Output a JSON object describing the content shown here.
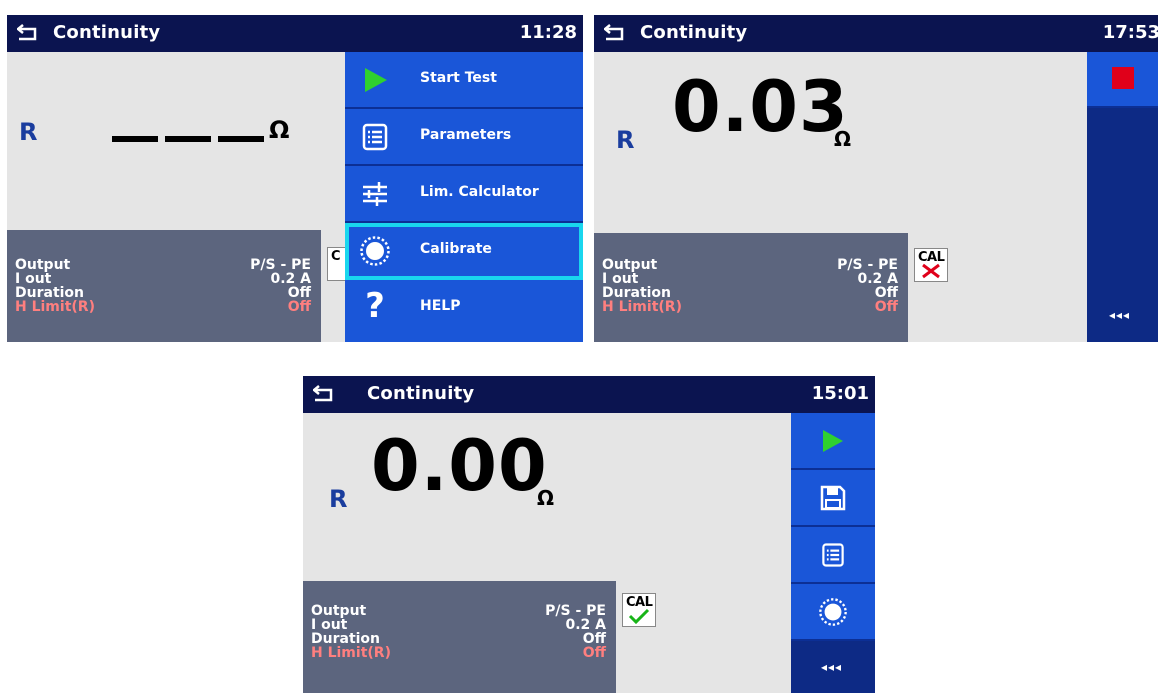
{
  "screens": [
    {
      "title": "Continuity",
      "time": "11:28",
      "r_label": "R",
      "unit": "Ω",
      "params": [
        {
          "label": "Output",
          "value": "P/S - PE"
        },
        {
          "label": "I out",
          "value": "0.2 A"
        },
        {
          "label": "Duration",
          "value": "Off"
        },
        {
          "label": "H Limit(R)",
          "value": "Off"
        }
      ],
      "menu": [
        {
          "label": "Start Test",
          "icon": "play-icon"
        },
        {
          "label": "Parameters",
          "icon": "list-icon"
        },
        {
          "label": "Lim. Calculator",
          "icon": "sliders-icon"
        },
        {
          "label": "Calibrate",
          "icon": "calibrate-icon",
          "selected": true
        },
        {
          "label": "HELP",
          "icon": "help-icon"
        }
      ]
    },
    {
      "title": "Continuity",
      "time": "17:53",
      "r_label": "R",
      "value": "0.03",
      "unit": "Ω",
      "cal_text": "CAL",
      "cal_status": "not-calibrated",
      "params": [
        {
          "label": "Output",
          "value": "P/S - PE"
        },
        {
          "label": "I out",
          "value": "0.2 A"
        },
        {
          "label": "Duration",
          "value": "Off"
        },
        {
          "label": "H Limit(R)",
          "value": "Off"
        }
      ],
      "side_more": "◂◂◂"
    },
    {
      "title": "Continuity",
      "time": "15:01",
      "r_label": "R",
      "value": "0.00",
      "unit": "Ω",
      "cal_text": "CAL",
      "cal_status": "calibrated",
      "params": [
        {
          "label": "Output",
          "value": "P/S - PE"
        },
        {
          "label": "I out",
          "value": "0.2 A"
        },
        {
          "label": "Duration",
          "value": "Off"
        },
        {
          "label": "H Limit(R)",
          "value": "Off"
        }
      ],
      "side_more": "◂◂◂"
    }
  ],
  "colors": {
    "title_bar": "#0b1450",
    "menu_blue": "#1a56d8",
    "panel_gray": "#5c657e",
    "selection": "#19d6ee",
    "play_green": "#2fd12f",
    "stop_red": "#e0001a",
    "limit_red": "#ff7f7f"
  }
}
